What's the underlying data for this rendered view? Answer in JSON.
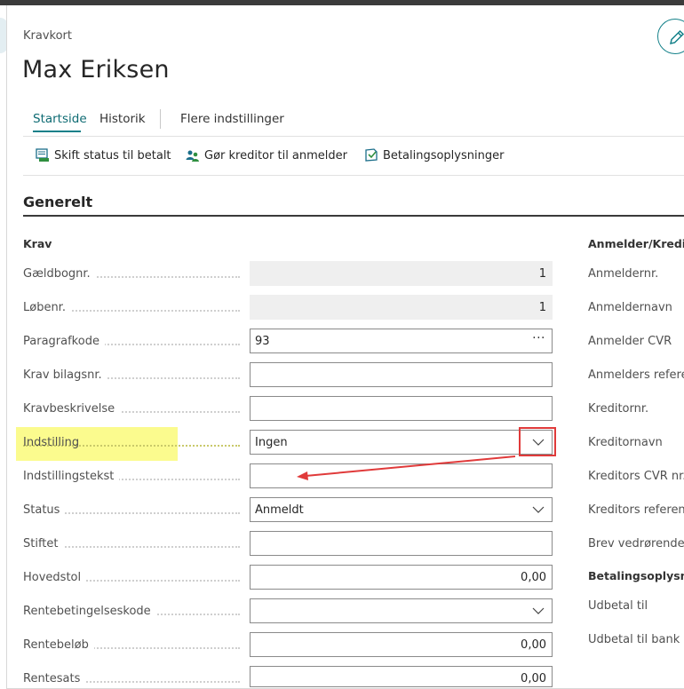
{
  "page": {
    "breadcrumb": "Kravkort",
    "title": "Max Eriksen"
  },
  "tabs": [
    {
      "label": "Startside",
      "active": true
    },
    {
      "label": "Historik",
      "active": false
    },
    {
      "label": "Flere indstillinger",
      "active": false
    }
  ],
  "actions": [
    {
      "label": "Skift status til betalt",
      "icon": "document-status-icon"
    },
    {
      "label": "Gør kreditor til anmelder",
      "icon": "people-icon"
    },
    {
      "label": "Betalingsoplysninger",
      "icon": "payment-info-icon"
    }
  ],
  "section": {
    "title": "Generelt"
  },
  "krav": {
    "title": "Krav",
    "fields": [
      {
        "label": "Gældbognr.",
        "value": "1",
        "type": "readonly"
      },
      {
        "label": "Løbenr.",
        "value": "1",
        "type": "readonly"
      },
      {
        "label": "Paragrafkode",
        "value": "93",
        "type": "lookup"
      },
      {
        "label": "Krav bilagsnr.",
        "value": "",
        "type": "text"
      },
      {
        "label": "Kravbeskrivelse",
        "value": "",
        "type": "text"
      },
      {
        "label": "Indstilling",
        "value": "Ingen",
        "type": "select"
      },
      {
        "label": "Indstillingstekst",
        "value": "",
        "type": "text"
      },
      {
        "label": "Status",
        "value": "Anmeldt",
        "type": "select"
      },
      {
        "label": "Stiftet",
        "value": "",
        "type": "text"
      },
      {
        "label": "Hovedstol",
        "value": "0,00",
        "type": "number"
      },
      {
        "label": "Rentebetingelseskode",
        "value": "",
        "type": "select"
      },
      {
        "label": "Rentebeløb",
        "value": "0,00",
        "type": "number"
      },
      {
        "label": "Rentesats",
        "value": "0,00",
        "type": "number"
      }
    ]
  },
  "anmelder": {
    "title": "Anmelder/Kredit",
    "labels": [
      "Anmeldernr.",
      "Anmeldernavn",
      "Anmelder CVR",
      "Anmelders refere",
      "Kreditornr.",
      "Kreditornavn",
      "Kreditors CVR nr.",
      "Kreditors referen",
      "Brev vedrørende"
    ]
  },
  "betaling": {
    "title": "Betalingsoplysni",
    "labels": [
      "Udbetal til",
      "Udbetal til bank"
    ]
  },
  "colors": {
    "accent": "#138089",
    "highlight": "#fafa7a",
    "annotation": "#e03a3a"
  }
}
